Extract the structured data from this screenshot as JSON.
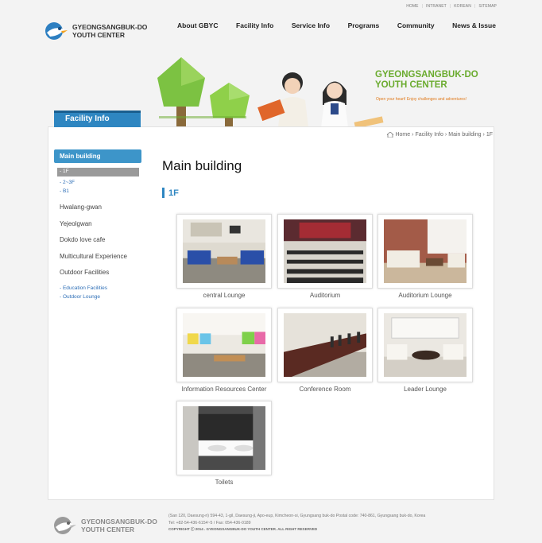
{
  "util_links": [
    "HOME",
    "INTRANET",
    "KOREAN",
    "SITEMAP"
  ],
  "logo": {
    "line1": "GYEONGSANGBUK-DO",
    "line2": "YOUTH CENTER"
  },
  "gnb": [
    "About GBYC",
    "Facility Info",
    "Service Info",
    "Programs",
    "Community",
    "News & Issue"
  ],
  "banner": {
    "title1": "GYEONGSANGBUK-DO",
    "title2": "YOUTH CENTER",
    "sub": "Open your heart! Enjoy challenges and adventures!"
  },
  "side_title": "Facility Info",
  "lnb": {
    "active": "Main building",
    "floors": [
      "- 1F",
      "- 2~3F",
      "- B1"
    ],
    "groups": [
      "Hwalang-gwan",
      "Yejeolgwan",
      "Dokdo love cafe",
      "Multicultural Experience",
      "Outdoor Facilities"
    ],
    "outdoor_sub": [
      "- Education Facilities",
      "- Outdoor Lounge"
    ]
  },
  "breadcrumb": {
    "home": "Home",
    "b1": "Facility Info",
    "b2": "Main building",
    "b3": "1F"
  },
  "page_title": "Main building",
  "section_title": "1F",
  "gallery": [
    "central Lounge",
    "Auditorium",
    "Auditorium Lounge",
    "Information Resources Center",
    "Conference Room",
    "Leader Lounge",
    "Toilets"
  ],
  "footer": {
    "logo1": "GYEONGSANGBUK-DO",
    "logo2": "YOUTH CENTER",
    "address": "(San 120, Daesung-ri) 594-43, 1-gil, Daesung-ji, Apo-eup, Kimcheon-si, Gyungsang buk-do Postal code: 740-861, Gyungsang buk-do, Korea",
    "tel": "Tel: +82-54-436-6154~5 / Fax: 054-436-0189",
    "copyright": "COPYRIGHT ⓒ 2014 . GYEONGSANGBUK-DO YOUTH CENTER. ALL RIGHT RESERVED"
  },
  "colors": {
    "accent": "#2e86c1",
    "green": "#6aab2e",
    "orange": "#e07a1c"
  }
}
